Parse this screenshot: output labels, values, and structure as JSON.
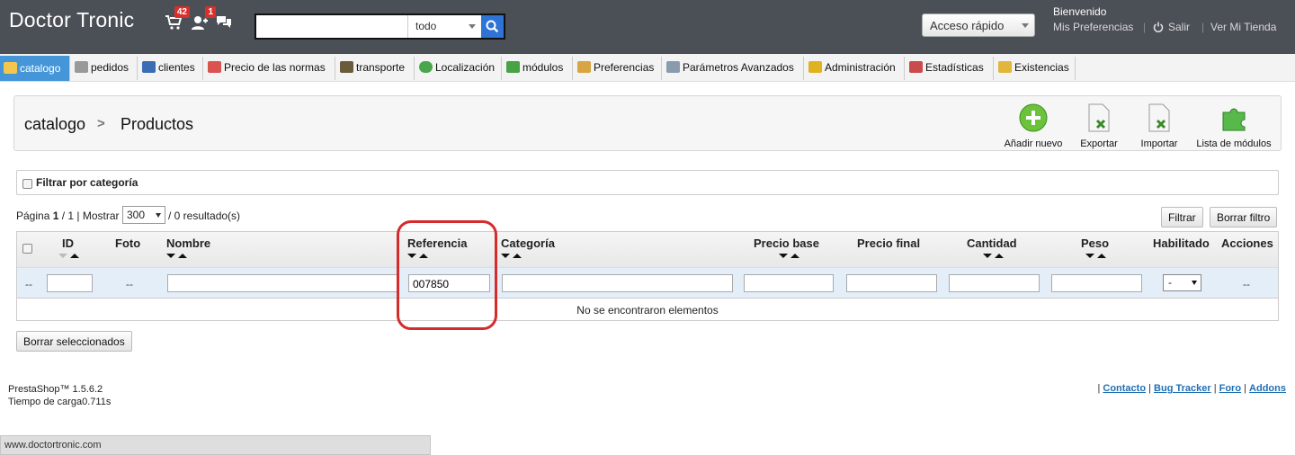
{
  "header": {
    "brand": "Doctor Tronic",
    "cart_badge": "42",
    "customers_badge": "1",
    "search_scope": "todo",
    "quick_access": "Acceso rápido",
    "welcome": "Bienvenido",
    "preferences_link": "Mis Preferencias",
    "logout_link": "Salir",
    "shop_link": "Ver Mi Tienda"
  },
  "tabs": [
    {
      "label": "catalogo",
      "icon": "folder-icon",
      "color": "#f3c64d"
    },
    {
      "label": "pedidos",
      "icon": "cart-icon",
      "color": "#999999"
    },
    {
      "label": "clientes",
      "icon": "user-icon",
      "color": "#3b6db5"
    },
    {
      "label": "Precio de las normas",
      "icon": "price-rules-icon",
      "color": "#d9534f"
    },
    {
      "label": "transporte",
      "icon": "truck-icon",
      "color": "#6a5b3a"
    },
    {
      "label": "Localización",
      "icon": "globe-icon",
      "color": "#4aa64a"
    },
    {
      "label": "módulos",
      "icon": "puzzle-icon",
      "color": "#46a346"
    },
    {
      "label": "Preferencias",
      "icon": "preferences-icon",
      "color": "#d9a442"
    },
    {
      "label": "Parámetros Avanzados",
      "icon": "wrench-icon",
      "color": "#8a9bb0"
    },
    {
      "label": "Administración",
      "icon": "key-icon",
      "color": "#e0b220"
    },
    {
      "label": "Estadísticas",
      "icon": "stats-icon",
      "color": "#c94b4b"
    },
    {
      "label": "Existencias",
      "icon": "stock-icon",
      "color": "#e2b63a"
    }
  ],
  "toolbar": {
    "breadcrumb_root": "catalogo",
    "breadcrumb_sep": ">",
    "page_title": "Productos",
    "add_new": "Añadir nuevo",
    "export": "Exportar",
    "import": "Importar",
    "modules_list": "Lista de módulos"
  },
  "filters": {
    "category_filter": "Filtrar por categoría",
    "page_prefix": "Página",
    "page_current": "1",
    "page_total": "/ 1 | Mostrar",
    "per_page": "300",
    "results": "/ 0 resultado(s)",
    "filter_button": "Filtrar",
    "reset_button": "Borrar filtro"
  },
  "table": {
    "columns": [
      "ID",
      "Foto",
      "Nombre",
      "Referencia",
      "Categoría",
      "Precio base",
      "Precio final",
      "Cantidad",
      "Peso",
      "Habilitado",
      "Acciones"
    ],
    "filter_reference_value": "007850",
    "filter_enabled_value": "-",
    "placeholder_dash": "--",
    "empty_message": "No se encontraron elementos"
  },
  "bulk_delete": "Borrar seleccionados",
  "footer": {
    "version": "PrestaShop™ 1.5.6.2",
    "load_time": "Tiempo de carga0.711s",
    "links": [
      "Contacto",
      "Bug Tracker",
      "Foro",
      "Addons"
    ]
  },
  "status_bar": "www.doctortronic.com",
  "colors": {
    "header_bg": "#4b4f56",
    "accent": "#4596d8",
    "highlight": "#d52b2b",
    "filter_row": "#e3eef9"
  }
}
